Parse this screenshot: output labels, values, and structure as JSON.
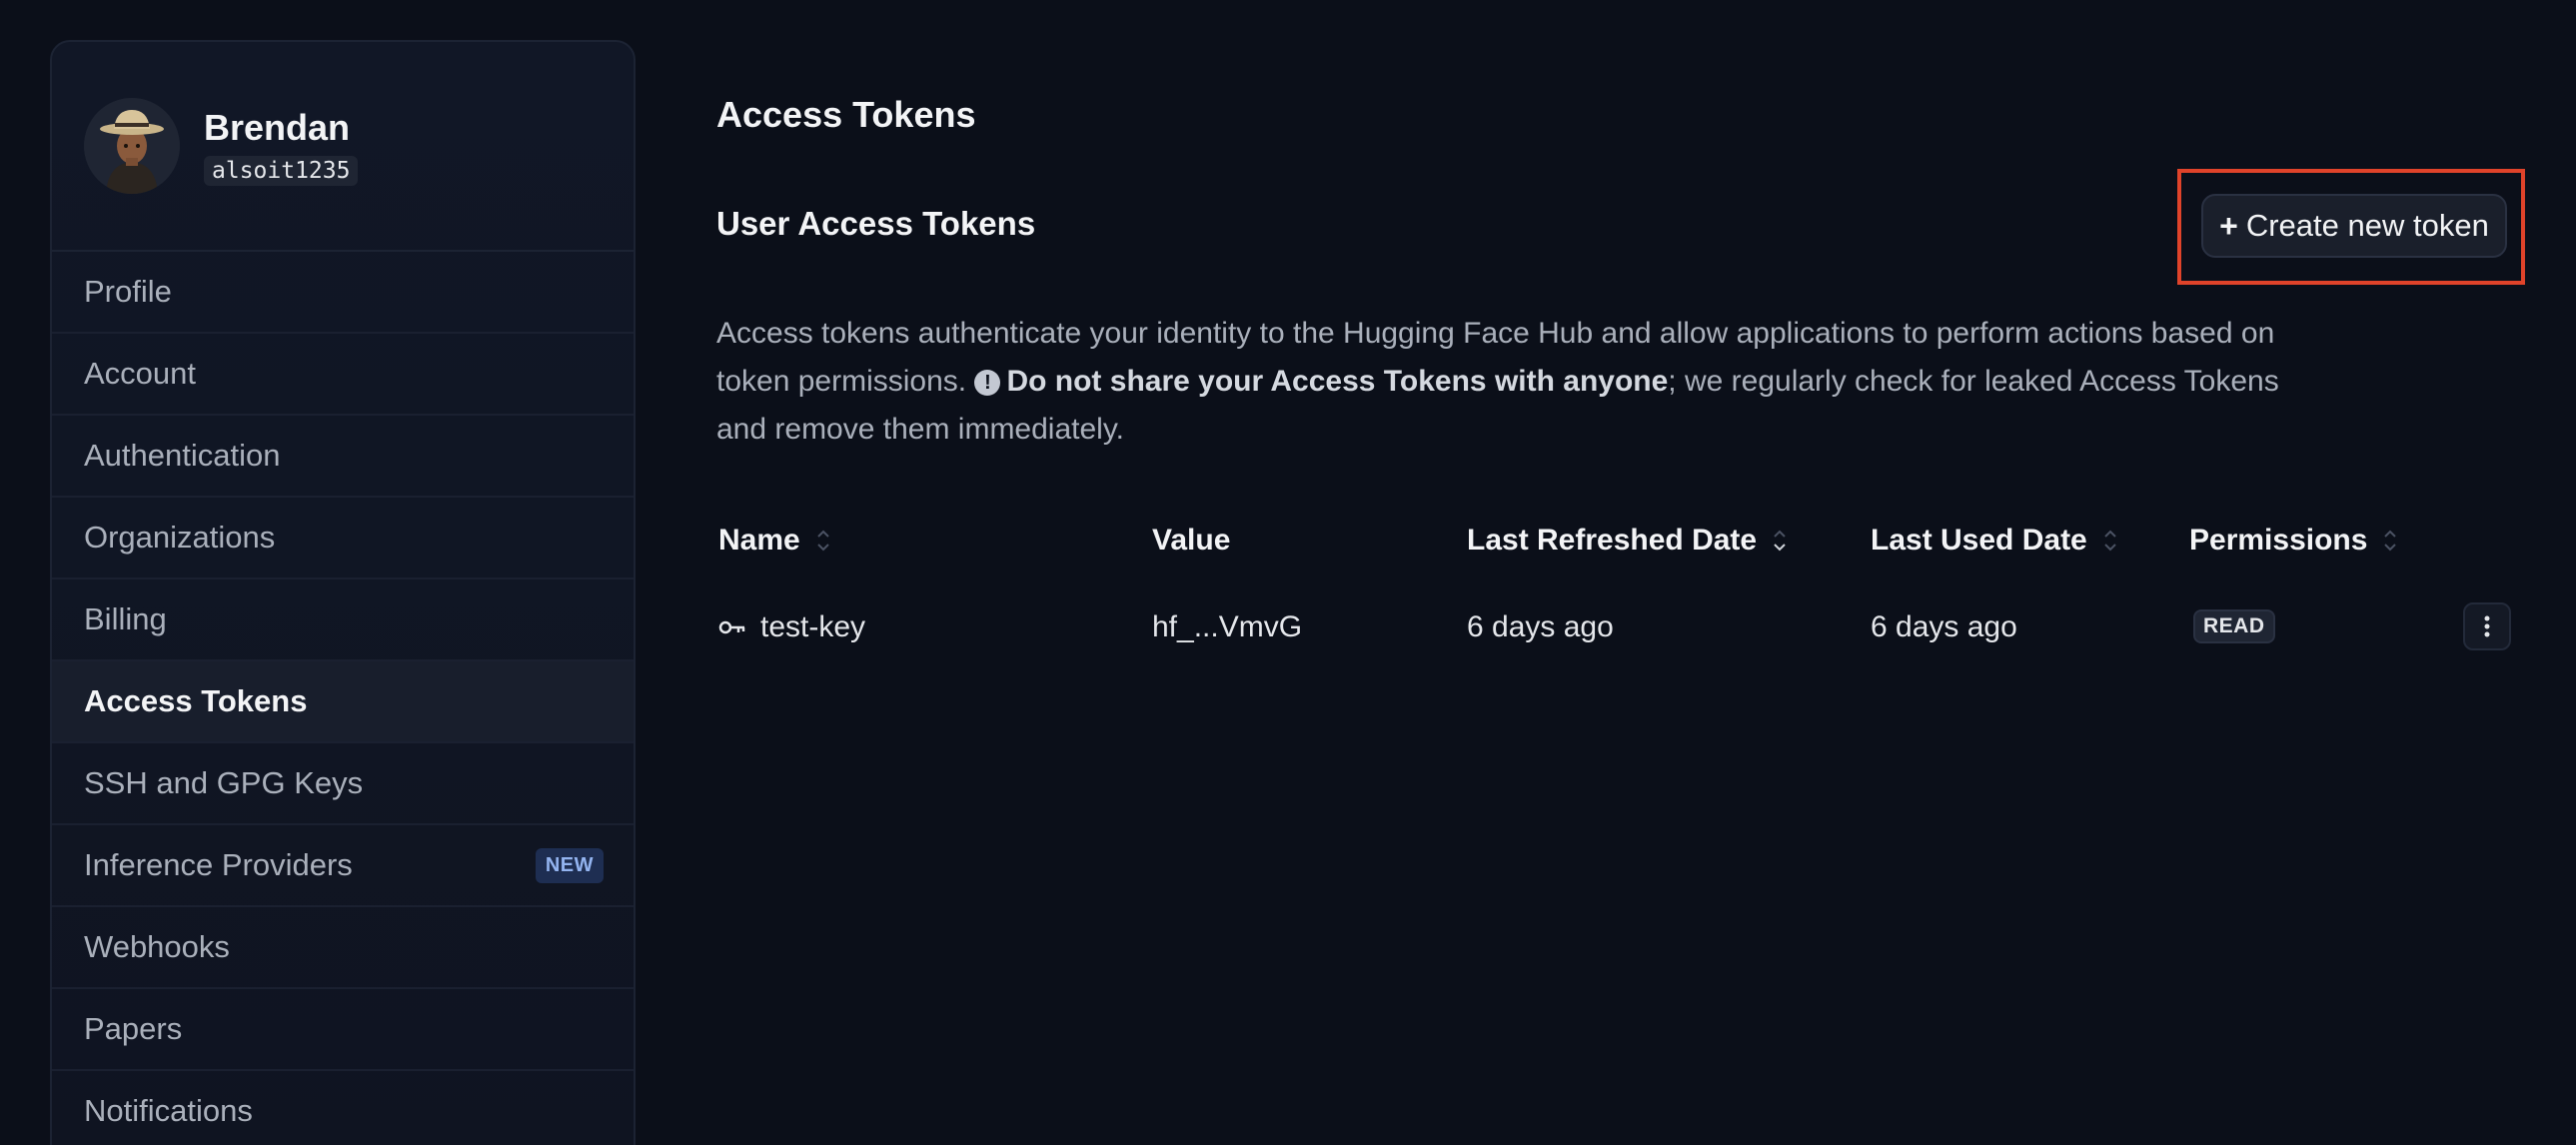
{
  "user": {
    "name": "Brendan",
    "handle": "alsoit1235",
    "avatar_icon": "avatar-cowboy-hat"
  },
  "sidebar": {
    "items": [
      {
        "label": "Profile"
      },
      {
        "label": "Account"
      },
      {
        "label": "Authentication"
      },
      {
        "label": "Organizations"
      },
      {
        "label": "Billing"
      },
      {
        "label": "Access Tokens",
        "active": true
      },
      {
        "label": "SSH and GPG Keys"
      },
      {
        "label": "Inference Providers",
        "badge": "NEW"
      },
      {
        "label": "Webhooks"
      },
      {
        "label": "Papers"
      },
      {
        "label": "Notifications"
      }
    ]
  },
  "main": {
    "page_title": "Access Tokens",
    "section_title": "User Access Tokens",
    "create_button": {
      "label": "Create new token",
      "icon": "plus-icon"
    },
    "description": {
      "part1": "Access tokens authenticate your identity to the Hugging Face Hub and allow applications to perform actions based on token permissions.",
      "bold1": "Do not share your ",
      "bold2": "Access Tokens",
      "bold3": " with anyone",
      "part2": "; we regularly check for leaked Access Tokens and remove them immediately."
    },
    "table": {
      "headers": {
        "name": "Name",
        "value": "Value",
        "last_refreshed": "Last Refreshed Date",
        "last_used": "Last Used Date",
        "permissions": "Permissions"
      },
      "rows": [
        {
          "name": "test-key",
          "value": "hf_...VmvG",
          "last_refreshed": "6 days ago",
          "last_used": "6 days ago",
          "permission": "READ"
        }
      ]
    }
  },
  "colors": {
    "background": "#0b0f19",
    "highlight": "#e0432a",
    "badge_new": "#93b4f0"
  }
}
